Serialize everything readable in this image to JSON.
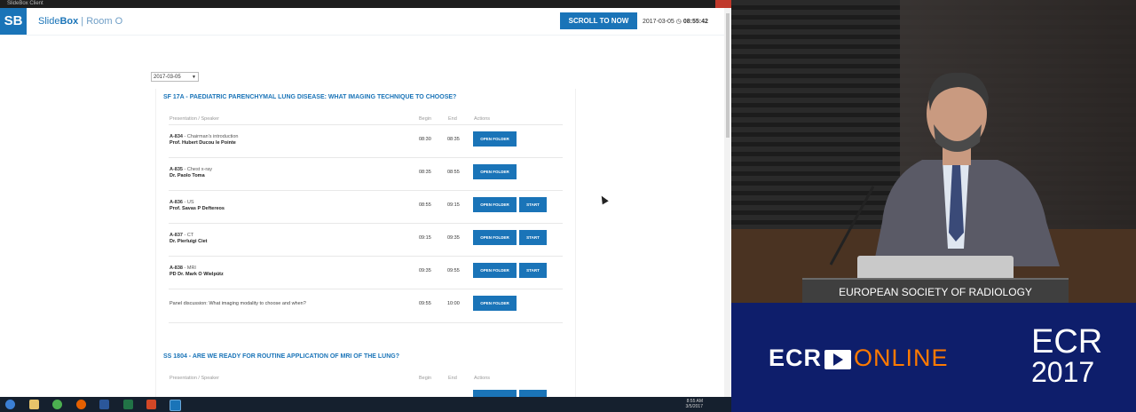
{
  "window": {
    "title": "SlideBox Client"
  },
  "app": {
    "logo": "SB",
    "brand_prefix": "Slide",
    "brand_bold": "Box",
    "room": " | Room O",
    "scroll_button": "SCROLL TO NOW",
    "date": "2017-03-05",
    "time": "08:55:42"
  },
  "date_select": {
    "value": "2017-03-05"
  },
  "sessions": [
    {
      "title": "SF 17A - PAEDIATRIC PARENCHYMAL LUNG DISEASE: WHAT IMAGING TECHNIQUE TO CHOOSE?",
      "headers": {
        "presentation": "Presentation / Speaker",
        "begin": "Begin",
        "end": "End",
        "actions": "Actions"
      },
      "rows": [
        {
          "code": "A-834",
          "topic": " - Chairman's introduction",
          "speaker": "Prof. Hubert Ducou le Pointe",
          "begin": "08:30",
          "end": "08:35",
          "open": "OPEN FOLDER",
          "start": ""
        },
        {
          "code": "A-835",
          "topic": " - Chest x-ray",
          "speaker": "Dr. Paolo Toma",
          "begin": "08:35",
          "end": "08:55",
          "open": "OPEN FOLDER",
          "start": ""
        },
        {
          "code": "A-836",
          "topic": " - US",
          "speaker": "Prof. Savas P Deftereos",
          "begin": "08:55",
          "end": "09:15",
          "open": "OPEN FOLDER",
          "start": "START"
        },
        {
          "code": "A-837",
          "topic": " - CT",
          "speaker": "Dr. Pierluigi Ciet",
          "begin": "09:15",
          "end": "09:35",
          "open": "OPEN FOLDER",
          "start": "START"
        },
        {
          "code": "A-838",
          "topic": " - MRI",
          "speaker": "PD Dr. Mark O Wielpütz",
          "begin": "09:35",
          "end": "09:55",
          "open": "OPEN FOLDER",
          "start": "START"
        },
        {
          "code": "",
          "topic": "Panel discussion: What imaging modality to choose and when?",
          "speaker": "",
          "begin": "09:55",
          "end": "10:00",
          "open": "OPEN FOLDER",
          "start": ""
        }
      ]
    },
    {
      "title": "SS 1804 - ARE WE READY FOR ROUTINE APPLICATION OF MRI OF THE LUNG?",
      "headers": {
        "presentation": "Presentation / Speaker",
        "begin": "Begin",
        "end": "End",
        "actions": "Actions"
      }
    }
  ],
  "taskbar": {
    "tray_time": "8:55 AM",
    "tray_date": "3/5/2017"
  },
  "video": {
    "podium_text": "EUROPEAN SOCIETY OF RADIOLOGY",
    "banner_ecr": "ECR",
    "banner_online": "ONLINE",
    "banner_logo_ecr": "ECR",
    "banner_logo_year": "2017"
  },
  "colors": {
    "accent": "#1a74b8",
    "banner": "#0e1e6b",
    "online_orange": "#ff7a00"
  }
}
